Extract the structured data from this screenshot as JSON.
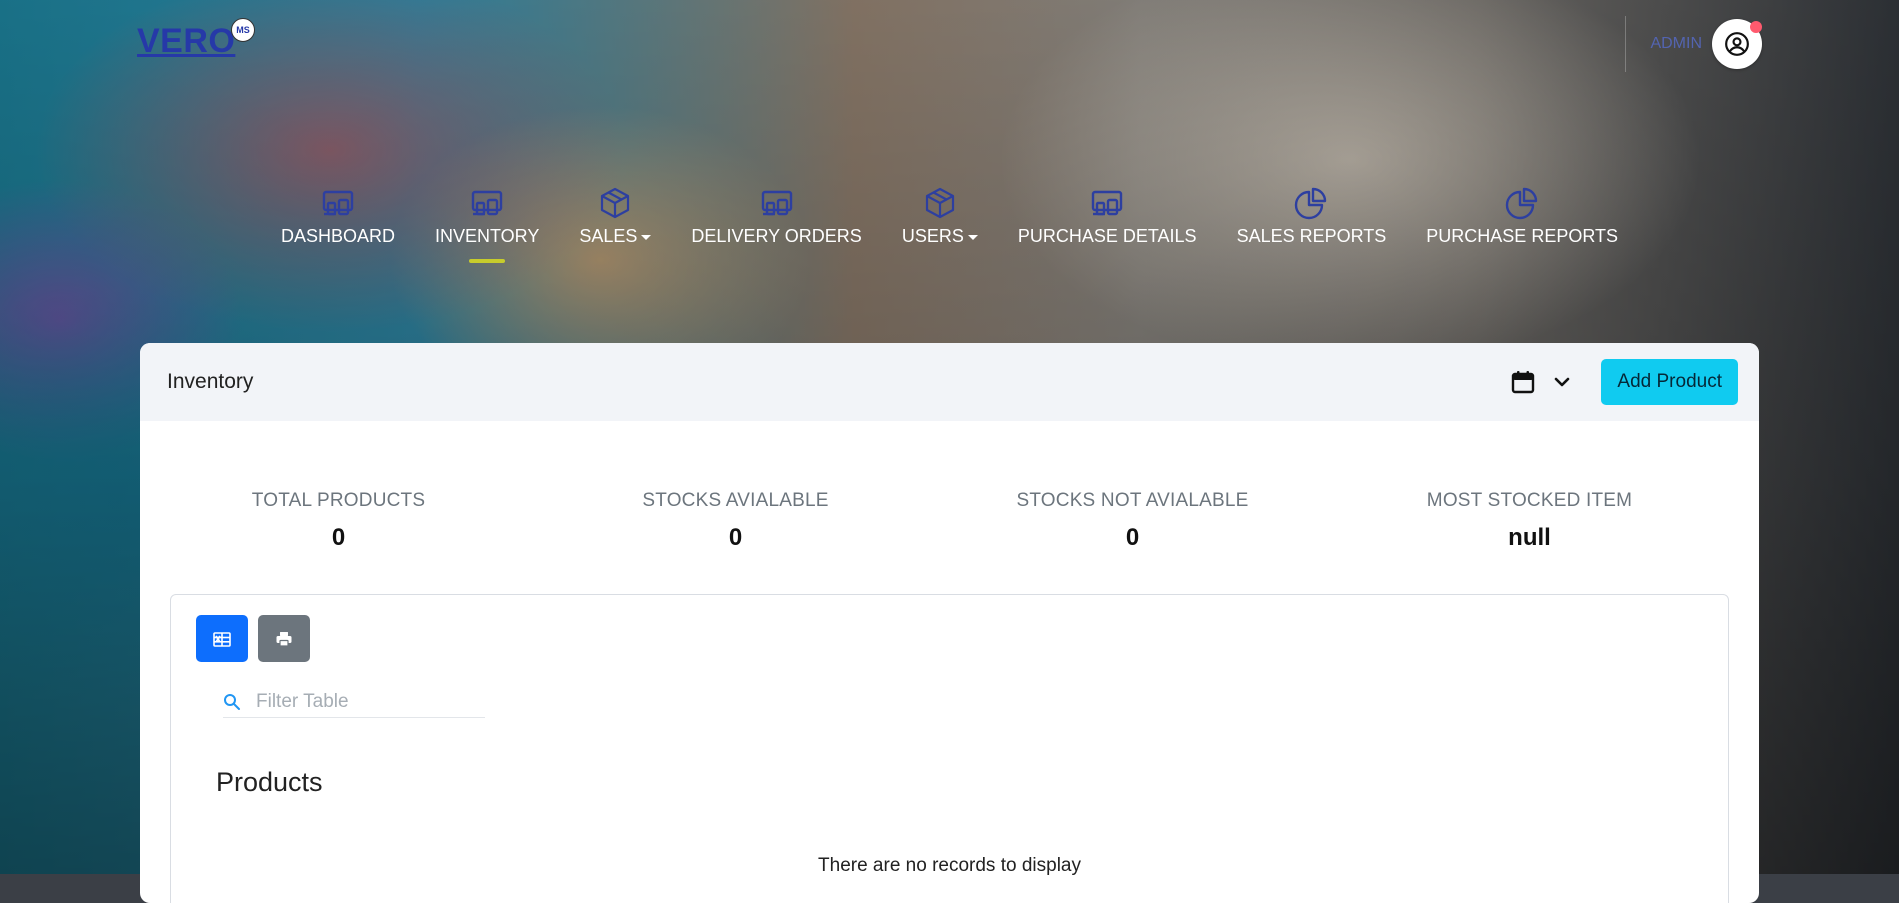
{
  "brand": {
    "name": "VERO",
    "badge": "MS"
  },
  "user": {
    "label": "ADMIN"
  },
  "nav": {
    "items": [
      {
        "label": "DASHBOARD",
        "icon": "devices-icon"
      },
      {
        "label": "INVENTORY",
        "icon": "devices-icon",
        "active": true
      },
      {
        "label": "SALES",
        "icon": "box-icon",
        "dropdown": true
      },
      {
        "label": "DELIVERY ORDERS",
        "icon": "devices-icon"
      },
      {
        "label": "USERS",
        "icon": "box-icon",
        "dropdown": true
      },
      {
        "label": "PURCHASE DETAILS",
        "icon": "devices-icon"
      },
      {
        "label": "SALES REPORTS",
        "icon": "pie-chart-icon"
      },
      {
        "label": "PURCHASE REPORTS",
        "icon": "pie-chart-icon"
      }
    ]
  },
  "card": {
    "title": "Inventory",
    "add_button": "Add Product"
  },
  "stats": [
    {
      "label": "TOTAL PRODUCTS",
      "value": "0"
    },
    {
      "label": "STOCKS AVIALABLE",
      "value": "0"
    },
    {
      "label": "STOCKS NOT AVIALABLE",
      "value": "0"
    },
    {
      "label": "MOST STOCKED ITEM",
      "value": "null"
    }
  ],
  "table": {
    "filter_placeholder": "Filter Table",
    "title": "Products",
    "empty_message": "There are no records to display"
  },
  "colors": {
    "brand": "#2639a8",
    "nav_icon": "#2d3fa0",
    "active_indicator": "#c7cc2c",
    "add_button": "#10cbf0",
    "excel_button": "#0d6efd",
    "print_button": "#6c757d",
    "notification": "#ff5a6e"
  }
}
